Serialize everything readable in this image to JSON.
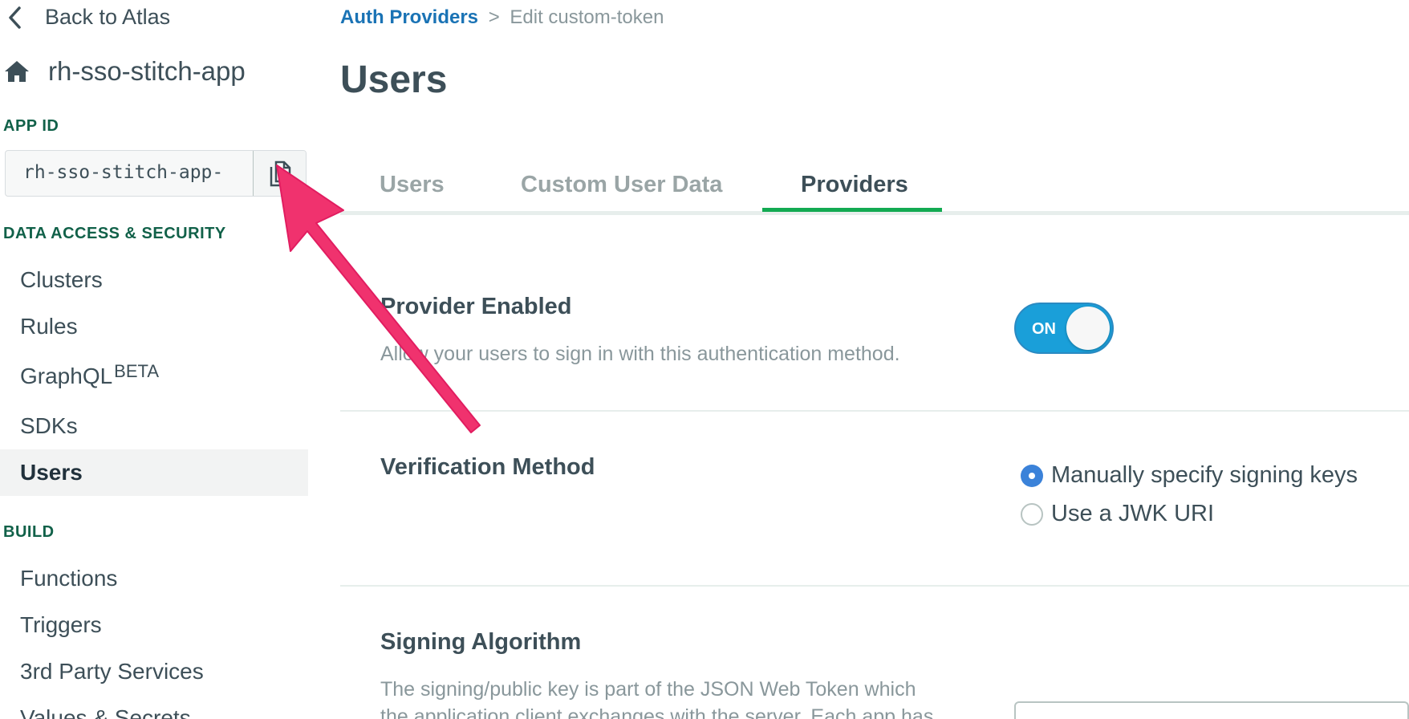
{
  "sidebar": {
    "back_label": "Back to Atlas",
    "app_name": "rh-sso-stitch-app",
    "app_id_heading": "APP ID",
    "app_id_value": "rh-sso-stitch-app-",
    "data_access_heading": "DATA ACCESS & SECURITY",
    "data_access_items": [
      {
        "label": "Clusters"
      },
      {
        "label": "Rules"
      },
      {
        "label": "GraphQL",
        "badge": "BETA"
      },
      {
        "label": "SDKs"
      },
      {
        "label": "Users",
        "active": true
      }
    ],
    "build_heading": "BUILD",
    "build_items": [
      {
        "label": "Functions"
      },
      {
        "label": "Triggers"
      },
      {
        "label": "3rd Party Services"
      },
      {
        "label": "Values & Secrets"
      }
    ]
  },
  "breadcrumb": {
    "link": "Auth Providers",
    "separator": ">",
    "current": "Edit custom-token"
  },
  "page_title": "Users",
  "tabs": [
    {
      "label": "Users"
    },
    {
      "label": "Custom User Data"
    },
    {
      "label": "Providers",
      "active": true
    }
  ],
  "provider_enabled": {
    "title": "Provider Enabled",
    "description": "Allow your users to sign in with this authentication method.",
    "toggle_label": "ON",
    "enabled": true
  },
  "verification_method": {
    "title": "Verification Method",
    "options": [
      {
        "label": "Manually specify signing keys",
        "checked": true
      },
      {
        "label": "Use a JWK URI",
        "checked": false
      }
    ]
  },
  "signing_algorithm": {
    "title": "Signing Algorithm",
    "description_line1": "The signing/public key is part of the JSON Web Token which",
    "description_line2": "the application client exchanges with the server. Each app has"
  },
  "colors": {
    "accent_green": "#13aa52",
    "section_heading": "#116149",
    "link_blue": "#1a73b5",
    "toggle_blue": "#1a9fd9",
    "radio_blue": "#3b82d9",
    "annotation_pink": "#f0326e"
  }
}
